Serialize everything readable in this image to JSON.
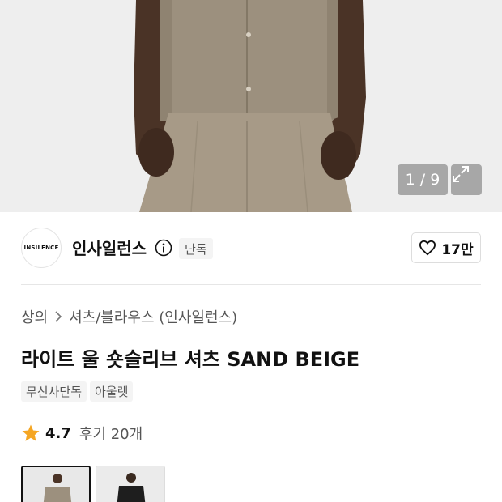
{
  "gallery": {
    "counter": "1 / 9",
    "expand_icon": "expand-icon"
  },
  "brand": {
    "logo_text": "INSILENCE",
    "name": "인사일런스",
    "info_icon": "info-icon",
    "badge": "단독"
  },
  "like": {
    "icon": "heart-outline-icon",
    "count": "17만"
  },
  "breadcrumb": {
    "level1": "상의",
    "separator_icon": "chevron-right-icon",
    "level2": "셔츠/블라우스 (인사일런스)"
  },
  "product": {
    "title": "라이트 울 숏슬리브 셔츠 SAND BEIGE",
    "tags": [
      "무신사단독",
      "아울렛"
    ]
  },
  "rating": {
    "star_icon": "star-icon",
    "star_color": "#f5a623",
    "value": "4.7",
    "reviews": "후기 20개"
  },
  "thumbnails": [
    {
      "icon": "thumbnail-image",
      "selected": true
    },
    {
      "icon": "thumbnail-image",
      "selected": false
    }
  ]
}
